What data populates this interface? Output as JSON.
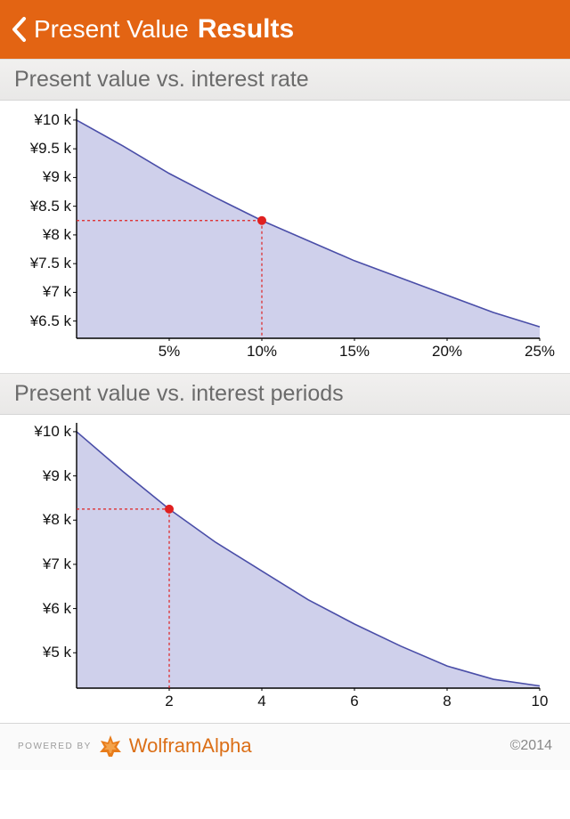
{
  "nav": {
    "back_label": "Present Value",
    "title": "Results"
  },
  "sections": {
    "rate": {
      "title": "Present value vs. interest rate"
    },
    "periods": {
      "title": "Present value vs. interest periods"
    }
  },
  "footer": {
    "powered_by": "POWERED BY",
    "brand": "WolframAlpha",
    "copyright": "©2014"
  },
  "chart_data": [
    {
      "id": "rate",
      "type": "area",
      "xlabel": "",
      "ylabel": "",
      "x_ticks": [
        5,
        10,
        15,
        20,
        25
      ],
      "x_tick_labels": [
        "5%",
        "10%",
        "15%",
        "20%",
        "25%"
      ],
      "xlim": [
        0,
        25
      ],
      "y_ticks": [
        6.5,
        7,
        7.5,
        8,
        8.5,
        9,
        9.5,
        10
      ],
      "y_tick_labels": [
        "¥6.5 k",
        "¥7 k",
        "¥7.5 k",
        "¥8 k",
        "¥8.5 k",
        "¥9 k",
        "¥9.5 k",
        "¥10 k"
      ],
      "ylim": [
        6.2,
        10.2
      ],
      "series": [
        {
          "name": "present value",
          "x": [
            0,
            2.5,
            5,
            7.5,
            10,
            12.5,
            15,
            17.5,
            20,
            22.5,
            25
          ],
          "values": [
            10,
            9.55,
            9.07,
            8.65,
            8.25,
            7.9,
            7.55,
            7.25,
            6.95,
            6.65,
            6.4
          ]
        }
      ],
      "marker": {
        "x": 10,
        "y": 8.25
      },
      "colors": {
        "line": "#4a4ea8",
        "fill": "#c7c8e7",
        "marker": "#e02020",
        "guide": "#e02020"
      }
    },
    {
      "id": "periods",
      "type": "area",
      "xlabel": "",
      "ylabel": "",
      "x_ticks": [
        2,
        4,
        6,
        8,
        10
      ],
      "x_tick_labels": [
        "2",
        "4",
        "6",
        "8",
        "10"
      ],
      "xlim": [
        0,
        10
      ],
      "y_ticks": [
        5,
        6,
        7,
        8,
        9,
        10
      ],
      "y_tick_labels": [
        "¥5 k",
        "¥6 k",
        "¥7 k",
        "¥8 k",
        "¥9 k",
        "¥10 k"
      ],
      "ylim": [
        4.2,
        10.2
      ],
      "series": [
        {
          "name": "present value",
          "x": [
            0,
            1,
            2,
            3,
            4,
            5,
            6,
            7,
            8,
            9,
            10
          ],
          "values": [
            10,
            9.1,
            8.25,
            7.5,
            6.85,
            6.2,
            5.65,
            5.15,
            4.7,
            4.4,
            4.25
          ]
        }
      ],
      "marker": {
        "x": 2,
        "y": 8.25
      },
      "colors": {
        "line": "#4a4ea8",
        "fill": "#c7c8e7",
        "marker": "#e02020",
        "guide": "#e02020"
      }
    }
  ]
}
